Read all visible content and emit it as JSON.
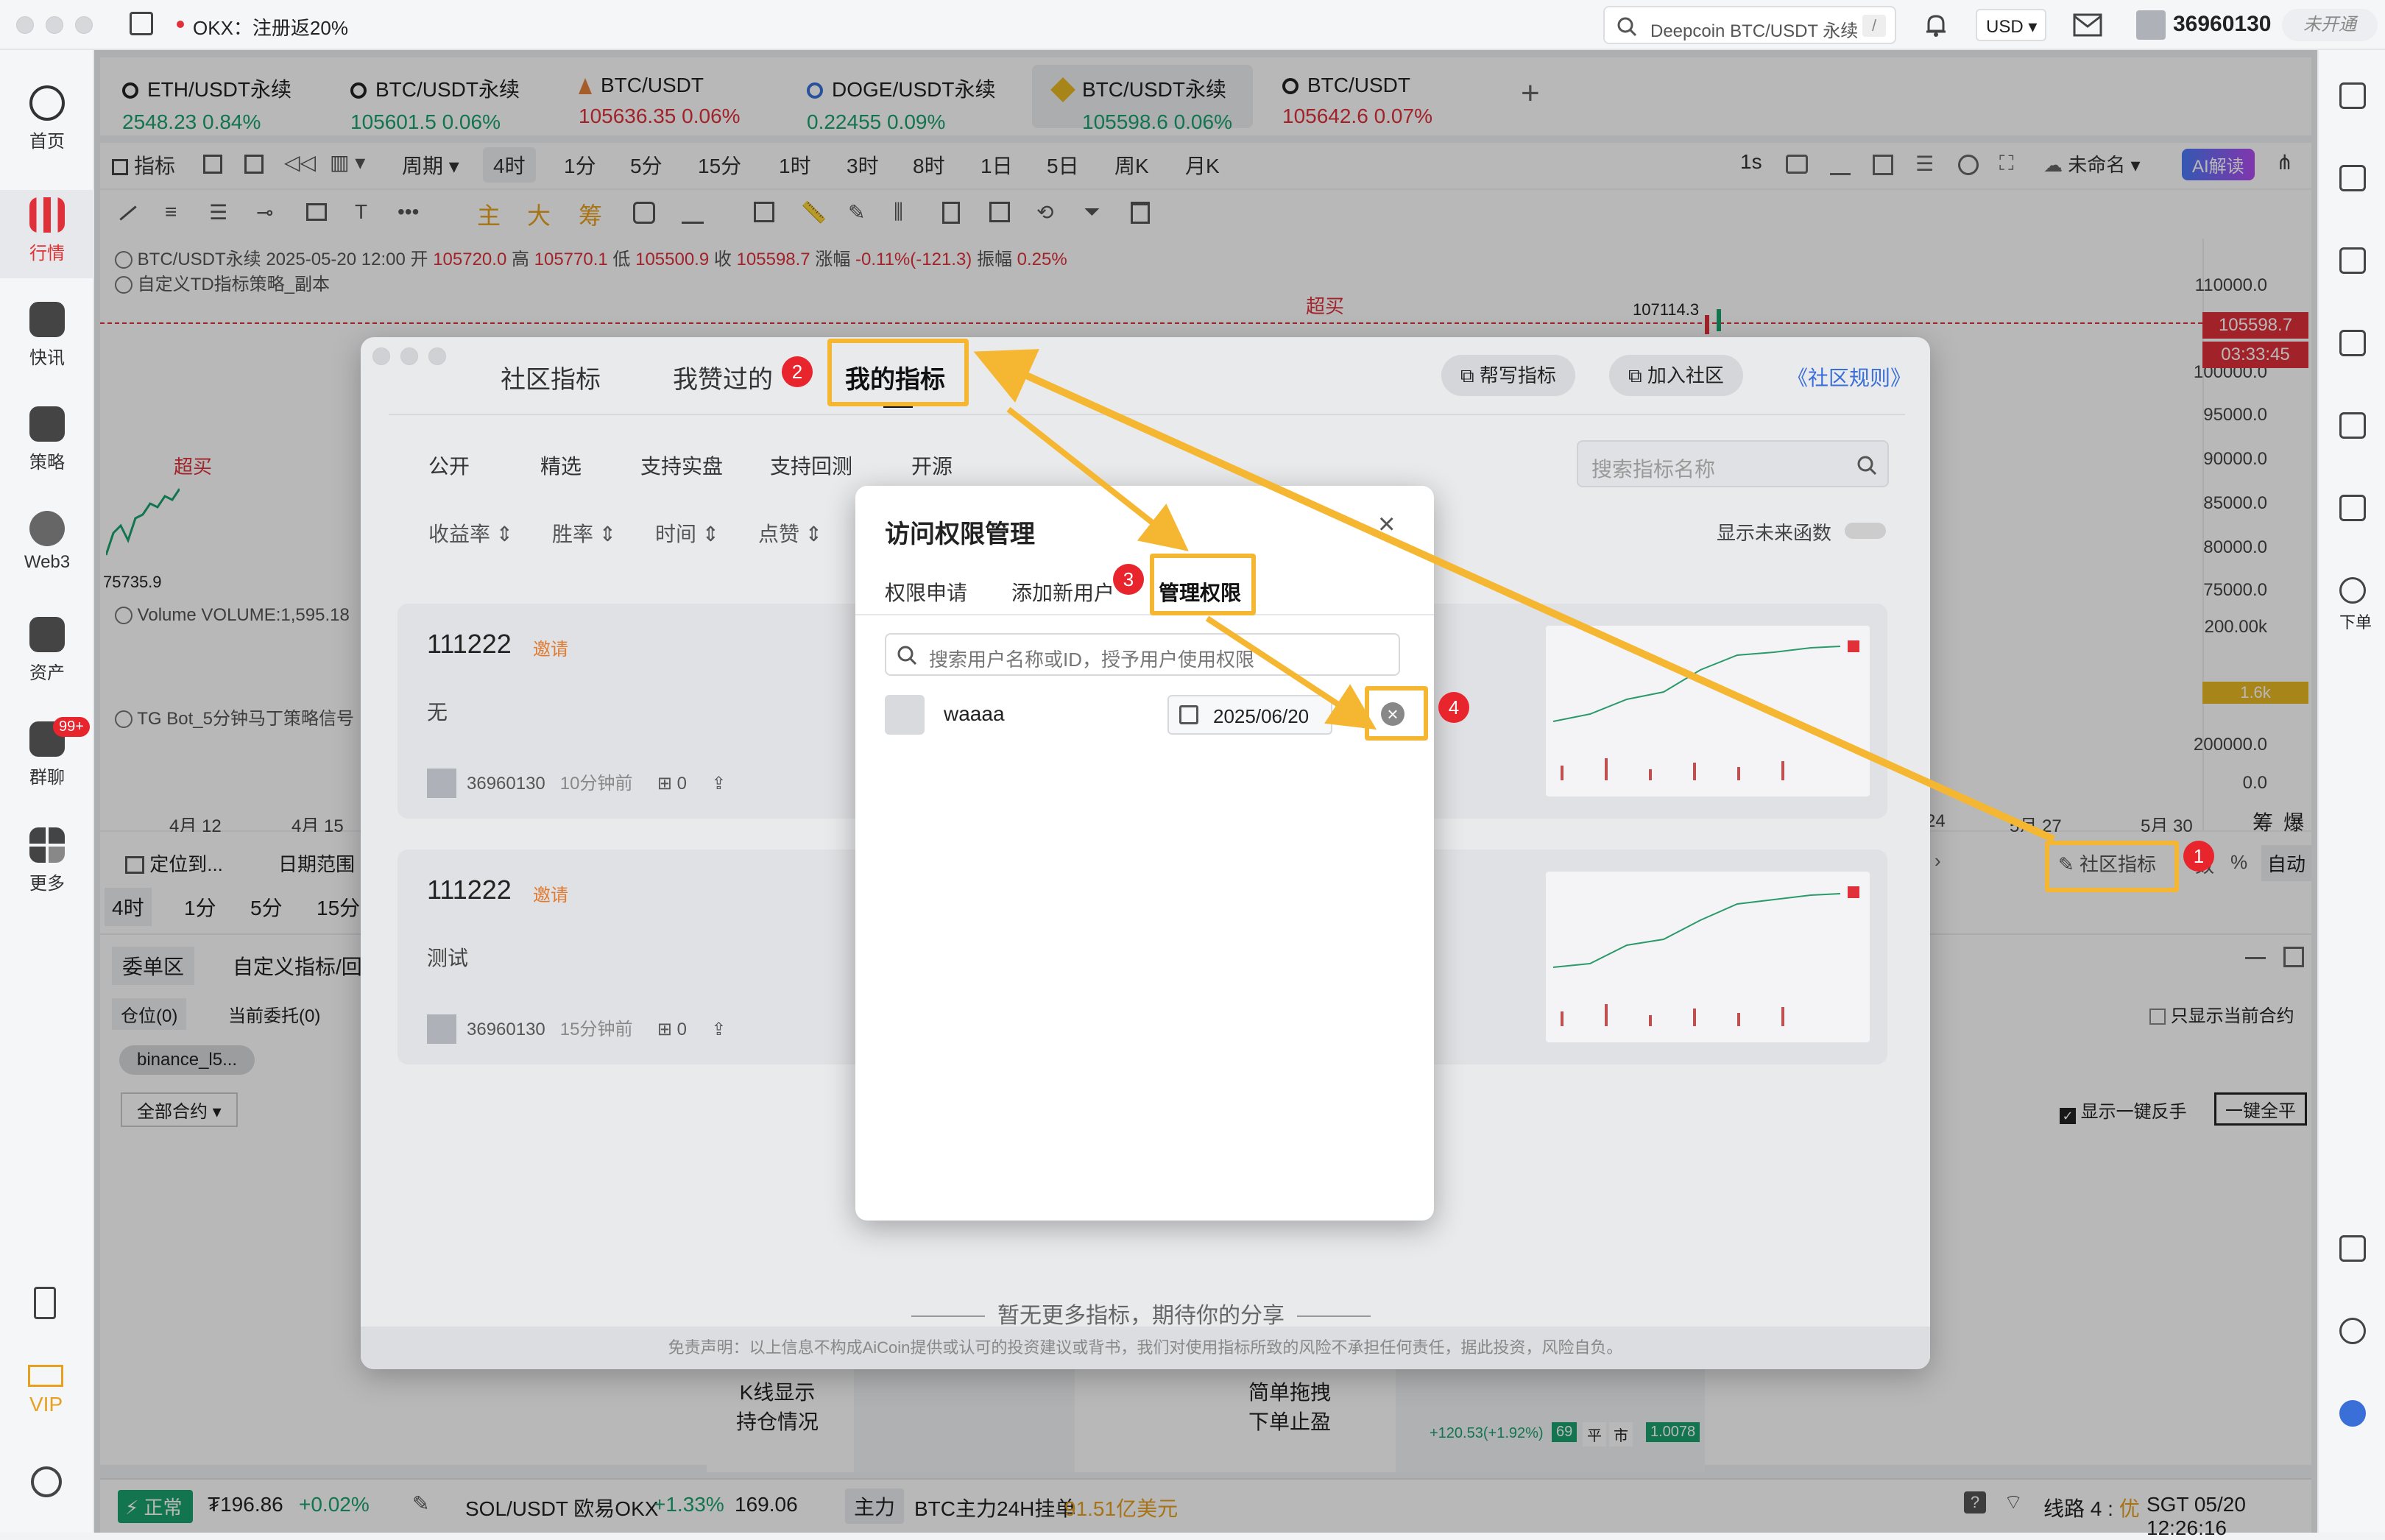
{
  "titlebar": {
    "promo": "OKX：注册返20%",
    "search_placeholder": "Deepcoin BTC/USDT 永续",
    "search_shortcut": "/",
    "currency": "USD",
    "user_id": "36960130",
    "status": "未开通"
  },
  "sidebar": {
    "items": [
      {
        "label": "首页"
      },
      {
        "label": "行情"
      },
      {
        "label": "快讯"
      },
      {
        "label": "策略"
      },
      {
        "label": "Web3"
      },
      {
        "label": "资产"
      },
      {
        "label": "群聊",
        "badge": "99+"
      },
      {
        "label": "更多"
      }
    ],
    "vip_label": "VIP"
  },
  "rightrail": {
    "order_label": "下单"
  },
  "tabs": [
    {
      "name": "ETH/USDT永续",
      "price": "2548.23",
      "change": "0.84%",
      "color": "#1aa36e"
    },
    {
      "name": "BTC/USDT永续",
      "price": "105601.5",
      "change": "0.06%",
      "color": "#1aa36e"
    },
    {
      "name": "BTC/USDT",
      "price": "105636.35",
      "change": "0.06%",
      "color": "#e0303a"
    },
    {
      "name": "DOGE/USDT永续",
      "price": "0.22455",
      "change": "0.09%",
      "color": "#1aa36e"
    },
    {
      "name": "BTC/USDT永续",
      "price": "105598.6",
      "change": "0.06%",
      "color": "#1aa36e"
    },
    {
      "name": "BTC/USDT",
      "price": "105642.6",
      "change": "0.07%",
      "color": "#e0303a"
    }
  ],
  "toolbar": {
    "indicator": "指标",
    "period": "周期",
    "intervals": [
      "4时",
      "1分",
      "5分",
      "15分",
      "1时",
      "3时",
      "8时",
      "1日",
      "5日",
      "周K",
      "月K"
    ],
    "speed": "1s",
    "unnamed": "未命名",
    "ai": "AI解读",
    "draw_labels": [
      "主",
      "大",
      "筹"
    ]
  },
  "chart": {
    "symbol_line": "BTC/USDT永续  2025-05-20 12:00",
    "open_label": "开",
    "open": "105720.0",
    "high_label": "高",
    "high": "105770.1",
    "low_label": "低",
    "low": "105500.9",
    "close_label": "收",
    "close": "105598.7",
    "change_label": "涨幅",
    "change": "-0.11%(-121.3)",
    "amp_label": "振幅",
    "amp": "0.25%",
    "strategy": "自定义TD指标策略_副本",
    "overbought": "超买",
    "peak": "107114.3",
    "low_mark": "75735.9",
    "volume": "Volume  VOLUME:1,595.18",
    "tg_bot": "TG Bot_5分钟马丁策略信号",
    "price_tag": "105598.7",
    "time_tag": "03:33:45",
    "vol_tag": "1.6k",
    "yaxis": [
      "110000.0",
      "105000.0",
      "100000.0",
      "95000.0",
      "90000.0",
      "85000.0",
      "80000.0",
      "75000.0",
      "200.00k",
      "200000.0",
      "0.0"
    ],
    "xaxis_left": [
      "4月 12",
      "4月 15"
    ],
    "xaxis_right": [
      "24",
      "5月 27",
      "5月 30"
    ],
    "corner_labels": [
      "筹",
      "爆"
    ]
  },
  "below_chart": {
    "locate": "定位到...",
    "date_range": "日期范围",
    "intervals": [
      "4时",
      "1分",
      "5分",
      "15分"
    ],
    "community_button": "社区指标",
    "pct": "%",
    "auto": "自动",
    "partial_label": "数"
  },
  "panel": {
    "tabs": [
      "委单区",
      "自定义指标/回"
    ],
    "subtabs": [
      "仓位(0)",
      "当前委托(0)"
    ],
    "chip": "binance_l5...",
    "all_contracts": "全部合约",
    "only_current": "只显示当前合约",
    "one_click_reverse": "显示一键反手",
    "close_all": "一键全平",
    "promo1": [
      "K线显示",
      "持仓情况"
    ],
    "promo2": [
      "简单拖拽",
      "下单止盈"
    ],
    "promo_val": "+120.53(+1.92%)",
    "promo_qty": "69",
    "promo_btns": [
      "平",
      "市"
    ],
    "promo_price": "1.0078"
  },
  "statusbar": {
    "status": "正常",
    "balance": "₮196.86",
    "balance_change": "+0.02%",
    "ticker": "SOL/USDT 欧易OKX",
    "ticker_change": "+1.33%",
    "ticker_price": "169.06",
    "main_tag": "主力",
    "main_text": "BTC主力24H挂单",
    "main_value": "91.51亿美元",
    "line": "线路 4 : ",
    "line_quality": "优",
    "time": "SGT  05/20 12:26:16"
  },
  "community_modal": {
    "tabs": [
      "社区指标",
      "我赞过的",
      "我的指标"
    ],
    "write_btn": "帮写指标",
    "join_btn": "加入社区",
    "rules_link": "《社区规则》",
    "filters": [
      "公开",
      "精选",
      "支持实盘",
      "支持回测",
      "开源"
    ],
    "sorts": [
      "收益率",
      "胜率",
      "时间",
      "点赞"
    ],
    "search_placeholder": "搜索指标名称",
    "future_toggle": "显示未来函数",
    "cards": [
      {
        "title": "111222",
        "invite": "邀请",
        "desc": "无",
        "user": "36960130",
        "time": "10分钟前",
        "saves": "0"
      },
      {
        "title": "111222",
        "invite": "邀请",
        "desc": "测试",
        "user": "36960130",
        "time": "15分钟前",
        "saves": "0"
      }
    ],
    "empty_msg": "暂无更多指标，期待你的分享",
    "disclaimer": "免责声明：以上信息不构成AiCoin提供或认可的投资建议或背书，我们对使用指标所致的风险不承担任何责任，据此投资，风险自负。"
  },
  "access_dialog": {
    "title": "访问权限管理",
    "tabs": [
      "权限申请",
      "添加新用户",
      "管理权限"
    ],
    "search_placeholder": "搜索用户名称或ID，授予用户使用权限",
    "user": "waaaa",
    "date": "2025/06/20"
  },
  "annotations": [
    "1",
    "2",
    "3",
    "4"
  ],
  "colors": {
    "accent": "#f5b731",
    "up": "#1aa36e",
    "down": "#e0303a",
    "badge": "#e8242c"
  }
}
